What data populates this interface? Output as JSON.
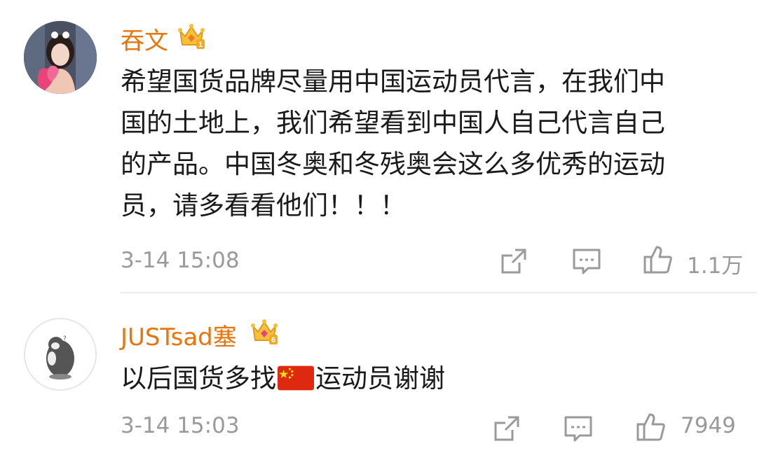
{
  "comments": [
    {
      "username": "吞文",
      "badge_icon": "vip-crown-badge-icon",
      "text_lines": [
        "希望国货品牌尽量用中国运动员代言，在我们中",
        "国的土地上，我们希望看到中国人自己代言自己",
        "的产品。中国冬奥和冬残奥会这么多优秀的运动",
        "员，请多看看他们！！！"
      ],
      "timestamp": "3-14 15:08",
      "like_count": "1.1万"
    },
    {
      "username": "JUSTsad塞",
      "badge_icon": "vip-crown-badge-icon",
      "text_before": "以后国货多找",
      "text_after": "运动员谢谢",
      "emoji": "china-flag-icon",
      "timestamp": "3-14 15:03",
      "like_count": "7949"
    }
  ],
  "colors": {
    "username": "#e8760e",
    "meta": "#9a9a9a",
    "text": "#1a1a1a"
  }
}
